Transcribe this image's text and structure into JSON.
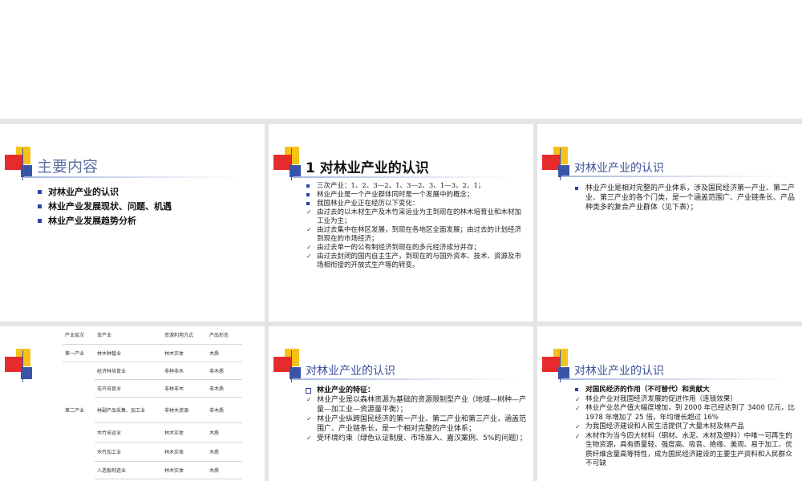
{
  "slides": {
    "s1": {
      "title": "主要内容",
      "items": [
        "对林业产业的认识",
        "林业产业发展现状、问题、机遇",
        "林业产业发展趋势分析"
      ]
    },
    "s2": {
      "title": "1  对林业产业的认识",
      "items": [
        "三次产业：1、2、3—2、1、3—2、3、1—3、2、1；",
        "林业产业是一个产业群体同时是一个发展中的概念；",
        "我国林业产业正在经历以下变化：",
        "由过去的以木材生产及木竹采运业为主到现在的林木培育业和木材加工业为主；",
        "由过去集中在林区发展，到现在各地区全面发展；由过去的计划经济到现在的市场经济；",
        "由过去单一的公有制经济到现在的多元经济成分并存；",
        "由过去封闭的国内自主生产，到现在的与国外资本、技术、资源及市场相衔接的开放式生产等的转变。"
      ]
    },
    "s3": {
      "title": "对林业产业的认识",
      "items": [
        "林业产业是相对完整的产业体系，涉及国民经济第一产业、第二产业、第三产业的各个门类，是一个涵盖范围广、产业链条长、产品种类多的复合产业群体（见下表）；"
      ]
    },
    "s4": {
      "headers": [
        "产业层次",
        "亚产业",
        "资源利用方式",
        "产品形态"
      ],
      "rows": [
        [
          "第一产业",
          "林木种植业",
          "林木实体",
          "木质"
        ],
        [
          "",
          "经济林培育业",
          "非林非木",
          "非木质"
        ],
        [
          "",
          "花卉培育业",
          "非林非木",
          "非木质"
        ],
        [
          "第二产业",
          "林副产品采集、加工业",
          "非林木资源",
          "非木质"
        ],
        [
          "",
          "木竹采运业",
          "林木实体",
          "木质"
        ],
        [
          "",
          "木竹加工业",
          "林木实体",
          "木质"
        ],
        [
          "",
          "人造板制造业",
          "林木实体",
          "木质"
        ]
      ]
    },
    "s5": {
      "title": "对林业产业的认识",
      "items": [
        "林业产业的特征：",
        "林业产业是以森林资源为基础的资源限制型产业（地域—树种—产量—加工业—资源量平衡）；",
        "林业产业纵跨国民经济的第一产业、第二产业和第三产业，涵盖范围广、产业链条长，是一个相对完整的产业体系；",
        "受环境约束（绿色认证制度、市场准入、嘉汉案例、5%的问题）；"
      ]
    },
    "s6": {
      "title": "对林业产业的认识",
      "items": [
        "对国民经济的作用（不可替代）和贡献大",
        "林业产业对我国经济发展的促进作用（连锁效果）",
        "林业产业总产值大幅度增加，到 2000 年已经达到了 3400 亿元，比 1978 年增加了 25 倍，年均增长超过 16%",
        "为我国经济建设和人民生活提供了大量木材及林产品",
        "木材作为当今四大材料（钢材、水泥、木材及塑料）中唯一可再生的生物资源，具有质量轻、强度高、吸音、绝缘、美观、易于加工、优质纤维含量高等特性，成为国民经济建设的主要生产资料和人民群众不可缺"
      ]
    }
  },
  "colors": {
    "accent_blue": "#2d3fa8",
    "accent_red": "#e52b2b",
    "accent_yellow": "#f4c21b",
    "title_blue": "#3a4f9a"
  }
}
